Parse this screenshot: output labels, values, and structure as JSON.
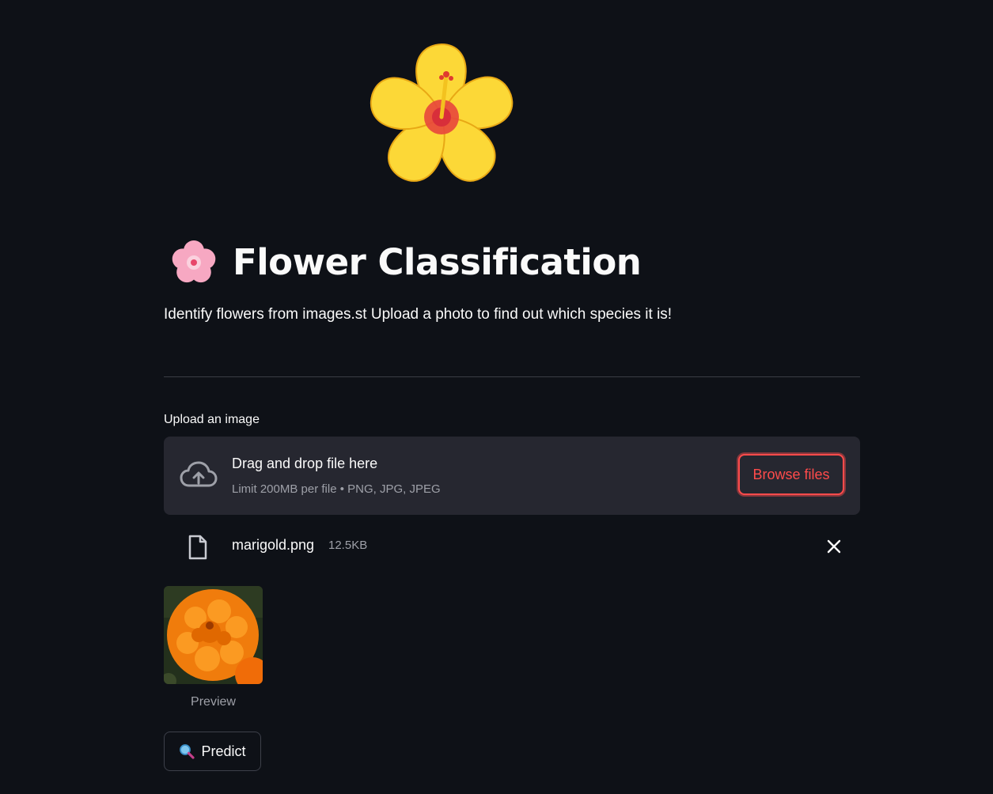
{
  "header": {
    "hero_icon": "hibiscus-icon",
    "title_icon": "cherry-blossom-icon",
    "title": "Flower Classification",
    "subtitle": "Identify flowers from images.st Upload a photo to find out which species it is!"
  },
  "uploader": {
    "label": "Upload an image",
    "icon": "cloud-upload-icon",
    "drop_title": "Drag and drop file here",
    "drop_limit": "Limit 200MB per file • PNG, JPG, JPEG",
    "browse_label": "Browse files",
    "accent_color": "#ff4b4b"
  },
  "file": {
    "icon": "file-icon",
    "name": "marigold.png",
    "size": "12.5KB",
    "remove_icon": "close-icon"
  },
  "preview": {
    "caption": "Preview"
  },
  "predict": {
    "icon": "magnifier-icon",
    "label": "Predict"
  },
  "theme": {
    "background": "#0e1117",
    "surface": "#262730",
    "text": "#fafafa",
    "muted": "#9ea0a8"
  }
}
